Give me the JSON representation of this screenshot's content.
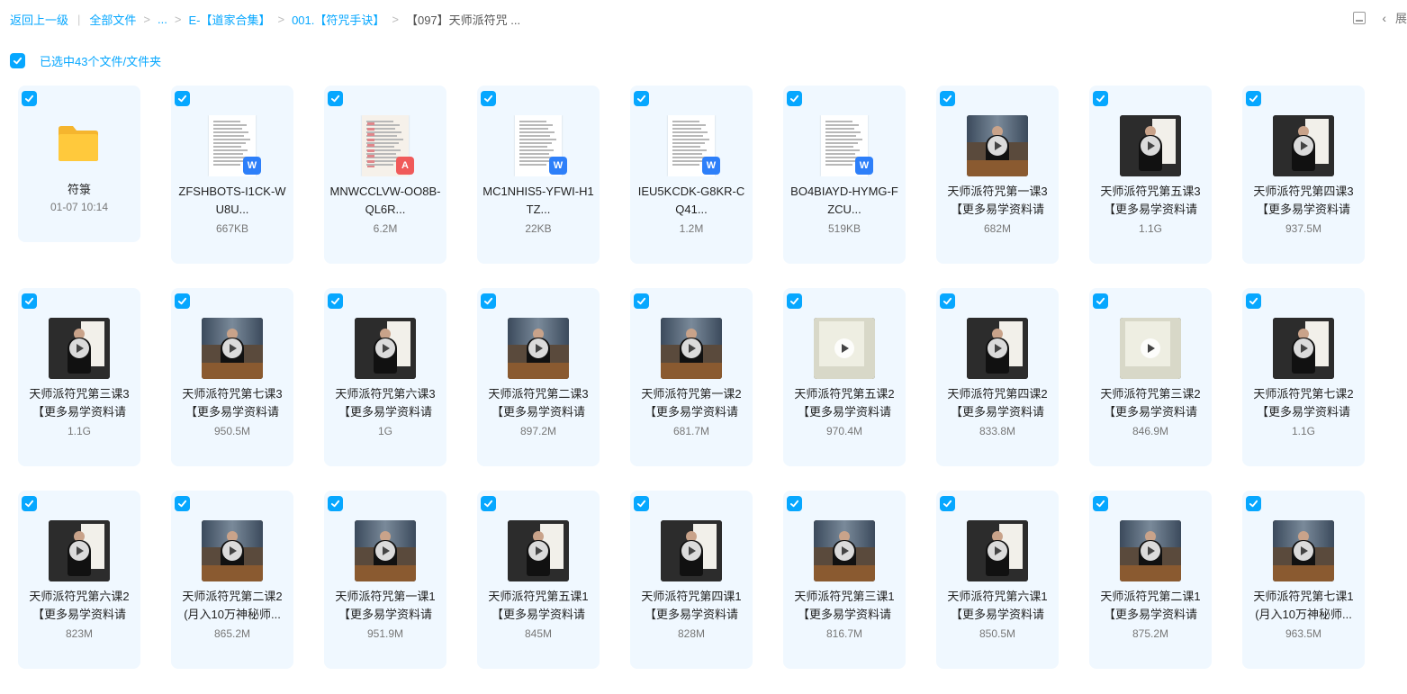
{
  "breadcrumb": {
    "back": "返回上一级",
    "items": [
      "全部文件",
      "...",
      "E-【道家合集】",
      "001.【符咒手诀】",
      "【097】天师派符咒 ..."
    ]
  },
  "toolbar": {
    "collapse_label": "展"
  },
  "selection": {
    "text": "已选中43个文件/文件夹"
  },
  "colors": {
    "accent": "#06a7ff",
    "card_bg": "#f0f8ff",
    "word": "#2d7ff9",
    "pdf": "#f05a5a",
    "folder": "#ffc93c"
  },
  "icons": {
    "checkbox": "check-icon",
    "folder": "folder-icon",
    "word": "word-icon",
    "pdf": "pdf-icon",
    "play": "play-icon"
  },
  "files": [
    {
      "kind": "folder",
      "name": "符箓",
      "meta": "01-07 10:14"
    },
    {
      "kind": "word",
      "name": "ZFSHBOTS-I1CK-WU8U...",
      "meta": "667KB"
    },
    {
      "kind": "pdf",
      "name": "MNWCCLVW-OO8B-QL6R...",
      "meta": "6.2M"
    },
    {
      "kind": "word",
      "name": "MC1NHIS5-YFWI-H1TZ...",
      "meta": "22KB"
    },
    {
      "kind": "word",
      "name": "IEU5KCDK-G8KR-CQ41...",
      "meta": "1.2M"
    },
    {
      "kind": "word",
      "name": "BO4BIAYD-HYMG-FZCU...",
      "meta": "519KB"
    },
    {
      "kind": "video",
      "name": "天师派符咒第一课3【更多易学资料请",
      "meta": "682M",
      "scene": "table"
    },
    {
      "kind": "video",
      "name": "天师派符咒第五课3【更多易学资料请",
      "meta": "1.1G",
      "scene": "board"
    },
    {
      "kind": "video",
      "name": "天师派符咒第四课3【更多易学资料请",
      "meta": "937.5M",
      "scene": "board"
    },
    {
      "kind": "video",
      "name": "天师派符咒第三课3【更多易学资料请",
      "meta": "1.1G",
      "scene": "board"
    },
    {
      "kind": "video",
      "name": "天师派符咒第七课3【更多易学资料请",
      "meta": "950.5M",
      "scene": "table"
    },
    {
      "kind": "video",
      "name": "天师派符咒第六课3【更多易学资料请",
      "meta": "1G",
      "scene": "board"
    },
    {
      "kind": "video",
      "name": "天师派符咒第二课3【更多易学资料请",
      "meta": "897.2M",
      "scene": "table"
    },
    {
      "kind": "video",
      "name": "天师派符咒第一课2【更多易学资料请",
      "meta": "681.7M",
      "scene": "table"
    },
    {
      "kind": "video",
      "name": "天师派符咒第五课2【更多易学资料请",
      "meta": "970.4M",
      "scene": "paper"
    },
    {
      "kind": "video",
      "name": "天师派符咒第四课2【更多易学资料请",
      "meta": "833.8M",
      "scene": "board"
    },
    {
      "kind": "video",
      "name": "天师派符咒第三课2【更多易学资料请",
      "meta": "846.9M",
      "scene": "paper"
    },
    {
      "kind": "video",
      "name": "天师派符咒第七课2【更多易学资料请",
      "meta": "1.1G",
      "scene": "board"
    },
    {
      "kind": "video",
      "name": "天师派符咒第六课2【更多易学资料请",
      "meta": "823M",
      "scene": "board"
    },
    {
      "kind": "video",
      "name": "天师派符咒第二课2(月入10万神秘师...",
      "meta": "865.2M",
      "scene": "table"
    },
    {
      "kind": "video",
      "name": "天师派符咒第一课1【更多易学资料请",
      "meta": "951.9M",
      "scene": "table"
    },
    {
      "kind": "video",
      "name": "天师派符咒第五课1【更多易学资料请",
      "meta": "845M",
      "scene": "board"
    },
    {
      "kind": "video",
      "name": "天师派符咒第四课1【更多易学资料请",
      "meta": "828M",
      "scene": "board"
    },
    {
      "kind": "video",
      "name": "天师派符咒第三课1【更多易学资料请",
      "meta": "816.7M",
      "scene": "table"
    },
    {
      "kind": "video",
      "name": "天师派符咒第六课1【更多易学资料请",
      "meta": "850.5M",
      "scene": "board"
    },
    {
      "kind": "video",
      "name": "天师派符咒第二课1【更多易学资料请",
      "meta": "875.2M",
      "scene": "table"
    },
    {
      "kind": "video",
      "name": "天师派符咒第七课1(月入10万神秘师...",
      "meta": "963.5M",
      "scene": "table"
    }
  ]
}
